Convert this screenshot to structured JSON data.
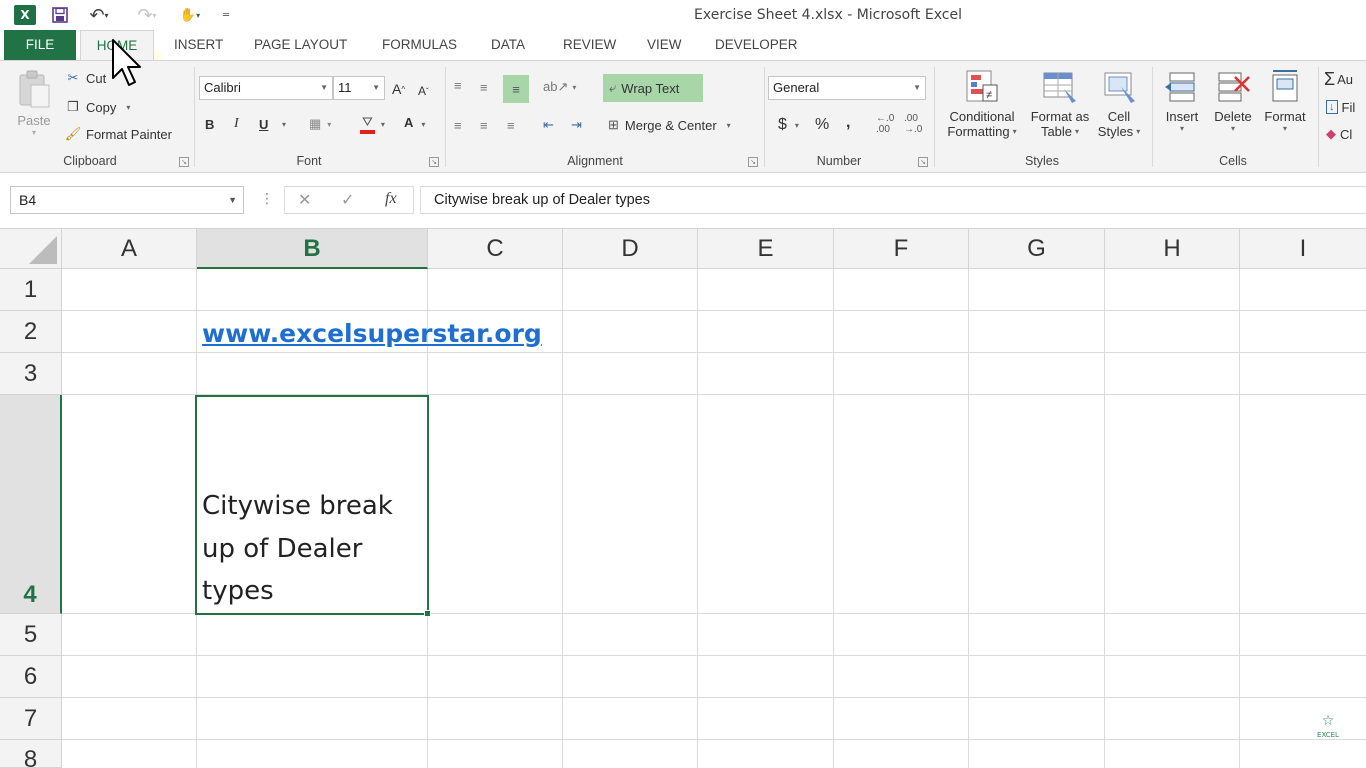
{
  "window": {
    "title": "Exercise Sheet 4.xlsx - Microsoft Excel"
  },
  "qat": {
    "app_icon": "X"
  },
  "tabs": [
    {
      "label": "FILE"
    },
    {
      "label": "HOME"
    },
    {
      "label": "INSERT"
    },
    {
      "label": "PAGE LAYOUT"
    },
    {
      "label": "FORMULAS"
    },
    {
      "label": "DATA"
    },
    {
      "label": "REVIEW"
    },
    {
      "label": "VIEW"
    },
    {
      "label": "DEVELOPER"
    }
  ],
  "ribbon": {
    "clipboard": {
      "label": "Clipboard",
      "paste": "Paste",
      "cut": "Cut",
      "copy": "Copy",
      "format_painter": "Format Painter"
    },
    "font": {
      "label": "Font",
      "family": "Calibri",
      "size": "11",
      "bold": "B",
      "italic": "I",
      "underline": "U"
    },
    "alignment": {
      "label": "Alignment",
      "wrap_text": "Wrap Text",
      "merge_center": "Merge & Center"
    },
    "number": {
      "label": "Number",
      "format": "General",
      "currency": "$",
      "percent": "%",
      "comma": ","
    },
    "styles": {
      "label": "Styles",
      "conditional_1": "Conditional",
      "conditional_2": "Formatting",
      "format_table_1": "Format as",
      "format_table_2": "Table",
      "cell_styles_1": "Cell",
      "cell_styles_2": "Styles"
    },
    "cells": {
      "label": "Cells",
      "insert": "Insert",
      "delete": "Delete",
      "format": "Format"
    },
    "editing": {
      "autosum": "Au",
      "fill": "Fil",
      "clear": "Cl"
    }
  },
  "formula_bar": {
    "name_box": "B4",
    "fx": "fx",
    "content": "Citywise break up of Dealer types"
  },
  "grid": {
    "columns": [
      "A",
      "B",
      "C",
      "D",
      "E",
      "F",
      "G",
      "H",
      "I"
    ],
    "rows": [
      "1",
      "2",
      "3",
      "4",
      "5",
      "6",
      "7",
      "8"
    ],
    "selected_column": "B",
    "selected_row": "4",
    "b2_link": "www.excelsuperstar.org",
    "b4_lines": [
      "Citywise break",
      "up of Dealer",
      "types"
    ]
  },
  "watermark": {
    "text": "EXCEL"
  },
  "colors": {
    "accent": "#217346",
    "link": "#1f6fd0",
    "ribbon_bg": "#f3f3f3"
  }
}
